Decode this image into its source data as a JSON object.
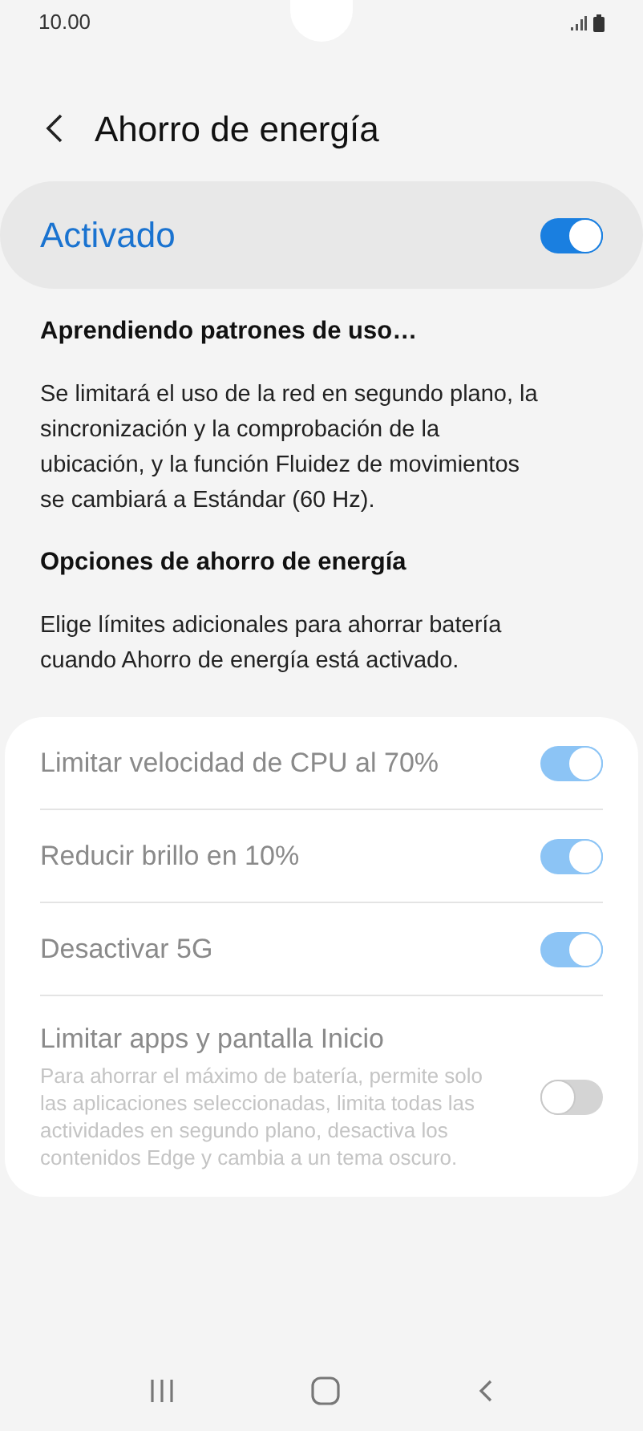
{
  "status_bar": {
    "time": "10.00"
  },
  "header": {
    "title": "Ahorro de energía"
  },
  "master": {
    "label": "Activado",
    "on": true
  },
  "sections": [
    {
      "heading": "Aprendiendo patrones de uso…",
      "body": "Se limitará el uso de la red en segundo plano, la sincronización y la comprobación de la ubicación, y la función Fluidez de movimientos se cambiará a Estándar (60 Hz)."
    },
    {
      "heading": "Opciones de ahorro de energía",
      "body": "Elige límites adicionales para ahorrar batería cuando Ahorro de energía está activado."
    }
  ],
  "options": [
    {
      "label": "Limitar velocidad de CPU al 70%",
      "on": true,
      "disabled": true
    },
    {
      "label": "Reducir brillo en 10%",
      "on": true,
      "disabled": true
    },
    {
      "label": "Desactivar 5G",
      "on": true,
      "disabled": true
    },
    {
      "label": "Limitar apps y pantalla Inicio",
      "description": "Para ahorrar el máximo de batería, permite solo las aplicaciones seleccionadas, limita todas las actividades en segundo plano, desactiva los contenidos Edge y cambia a un tema oscuro.",
      "on": false,
      "disabled": true
    }
  ]
}
